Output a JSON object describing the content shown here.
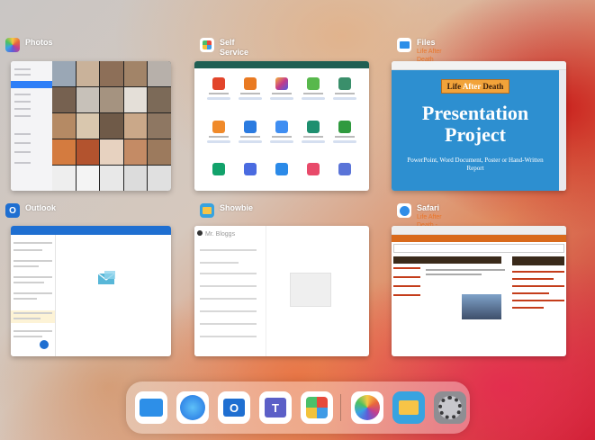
{
  "app_switcher": {
    "cards": [
      {
        "id": "photos",
        "title": "Photos",
        "subtitle": ""
      },
      {
        "id": "self-service",
        "title": "Self Service",
        "subtitle": ""
      },
      {
        "id": "files",
        "title": "Files",
        "subtitle": "Life After Death Presentation"
      },
      {
        "id": "outlook",
        "title": "Outlook",
        "subtitle": ""
      },
      {
        "id": "showbie",
        "title": "Showbie",
        "subtitle": ""
      },
      {
        "id": "safari",
        "title": "Safari",
        "subtitle": "Life After Death - Religious Studies"
      }
    ]
  },
  "files_preview": {
    "banner_pre": "Life",
    "banner_mid": "After",
    "banner_post": "Death",
    "title_line1": "Presentation",
    "title_line2": "Project",
    "note": "PowerPoint, Word Document, Poster or Hand-Written Report"
  },
  "showbie_preview": {
    "user": "Mr. Bloggs"
  },
  "dock": {
    "apps": [
      "Files",
      "Safari",
      "Outlook",
      "Teams",
      "Self Service",
      "Photos",
      "Showbie",
      "Settings"
    ]
  },
  "colors": {
    "files_subtitle": "#e9752a",
    "slide_blue": "#2d8fd0",
    "outlook_blue": "#1f6fd1",
    "self_service_green": "#1f5f53"
  }
}
